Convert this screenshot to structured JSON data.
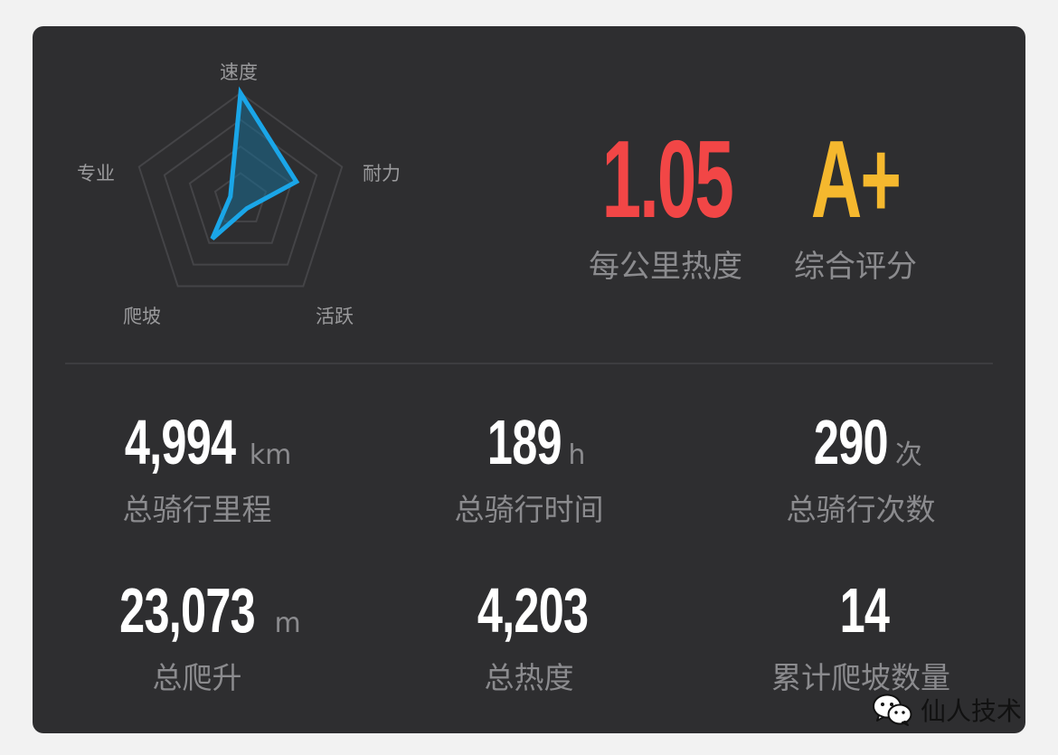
{
  "radar": {
    "axes": [
      "速度",
      "耐力",
      "活跃",
      "爬坡",
      "专业"
    ],
    "values": [
      1.0,
      0.55,
      0.1,
      0.45,
      0.1
    ],
    "stroke_color": "#1aa6e8",
    "fill_color": "#1a6e94"
  },
  "heat": {
    "value": "1.05",
    "label": "每公里热度",
    "color": "#f24646"
  },
  "rating": {
    "value": "A+",
    "label": "综合评分",
    "color": "#f5b82e"
  },
  "stats": [
    {
      "value": "4,994",
      "unit": "km",
      "label": "总骑行里程"
    },
    {
      "value": "189",
      "unit": "h",
      "label": "总骑行时间"
    },
    {
      "value": "290",
      "unit": "次",
      "label": "总骑行次数"
    },
    {
      "value": "23,073",
      "unit": "m",
      "label": "总爬升"
    },
    {
      "value": "4,203",
      "unit": "",
      "label": "总热度"
    },
    {
      "value": "14",
      "unit": "",
      "label": "累计爬坡数量"
    }
  ],
  "watermark": {
    "text": "仙人技术",
    "icon": "wechat-icon"
  }
}
